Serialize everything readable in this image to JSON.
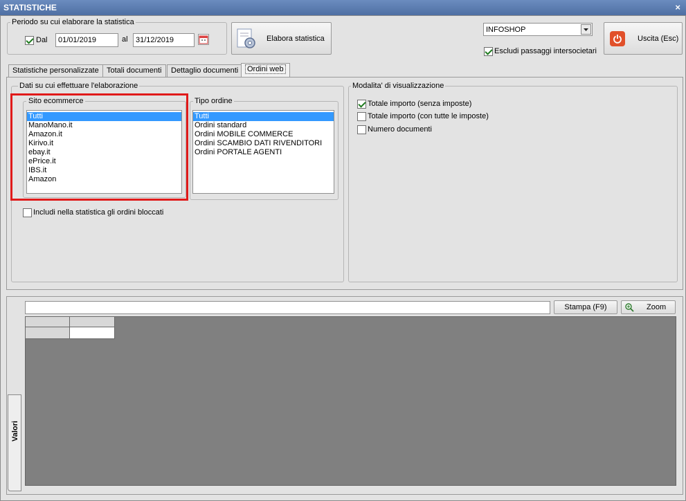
{
  "window": {
    "title": "STATISTICHE",
    "close_glyph": "×"
  },
  "period": {
    "group_title": "Periodo su cui elaborare la statistica",
    "dal_label": "Dal",
    "dal_checked": true,
    "date_from": "01/01/2019",
    "al_label": "al",
    "date_to": "31/12/2019",
    "calendar_icon": "calendar-icon"
  },
  "elabora_button": {
    "label": "Elabora statistica",
    "icon": "gear-document-icon"
  },
  "company_select": {
    "value": "INFOSHOP"
  },
  "escludi": {
    "label": "Escludi passaggi intersocietari",
    "checked": true
  },
  "exit_button": {
    "label": "Uscita (Esc)",
    "icon": "power-icon",
    "icon_color": "#e1502a"
  },
  "tabs": [
    {
      "label": "Statistiche personalizzate",
      "active": false
    },
    {
      "label": "Totali documenti",
      "active": false
    },
    {
      "label": "Dettaglio documenti",
      "active": false
    },
    {
      "label": "Ordini web",
      "active": true
    }
  ],
  "dati": {
    "group_title": "Dati su cui effettuare l'elaborazione",
    "sito": {
      "title": "Sito ecommerce",
      "items": [
        "Tutti",
        "ManoMano.it",
        "Amazon.it",
        "Kirivo.it",
        "ebay.it",
        "ePrice.it",
        "IBS.it",
        "Amazon"
      ],
      "selected_index": 0
    },
    "tipo": {
      "title": "Tipo ordine",
      "items": [
        "Tutti",
        "Ordini standard",
        "Ordini MOBILE COMMERCE",
        "Ordini SCAMBIO DATI RIVENDITORI",
        "Ordini PORTALE AGENTI"
      ],
      "selected_index": 0
    },
    "includi": {
      "label": "Includi nella statistica gli ordini bloccati",
      "checked": false
    }
  },
  "modalita": {
    "group_title": "Modalita' di visualizzazione",
    "options": [
      {
        "label": "Totale importo (senza imposte)",
        "checked": true
      },
      {
        "label": "Totale importo (con tutte le imposte)",
        "checked": false
      },
      {
        "label": "Numero documenti",
        "checked": false
      }
    ]
  },
  "results": {
    "search_value": "",
    "stampa_label": "Stampa (F9)",
    "zoom_label": "Zoom",
    "zoom_icon": "zoom-in-icon",
    "side_tab_label": "Valori"
  },
  "colors": {
    "highlight_red": "#e01a1a",
    "selection": "#3399ff",
    "grid_bg": "#808080"
  }
}
